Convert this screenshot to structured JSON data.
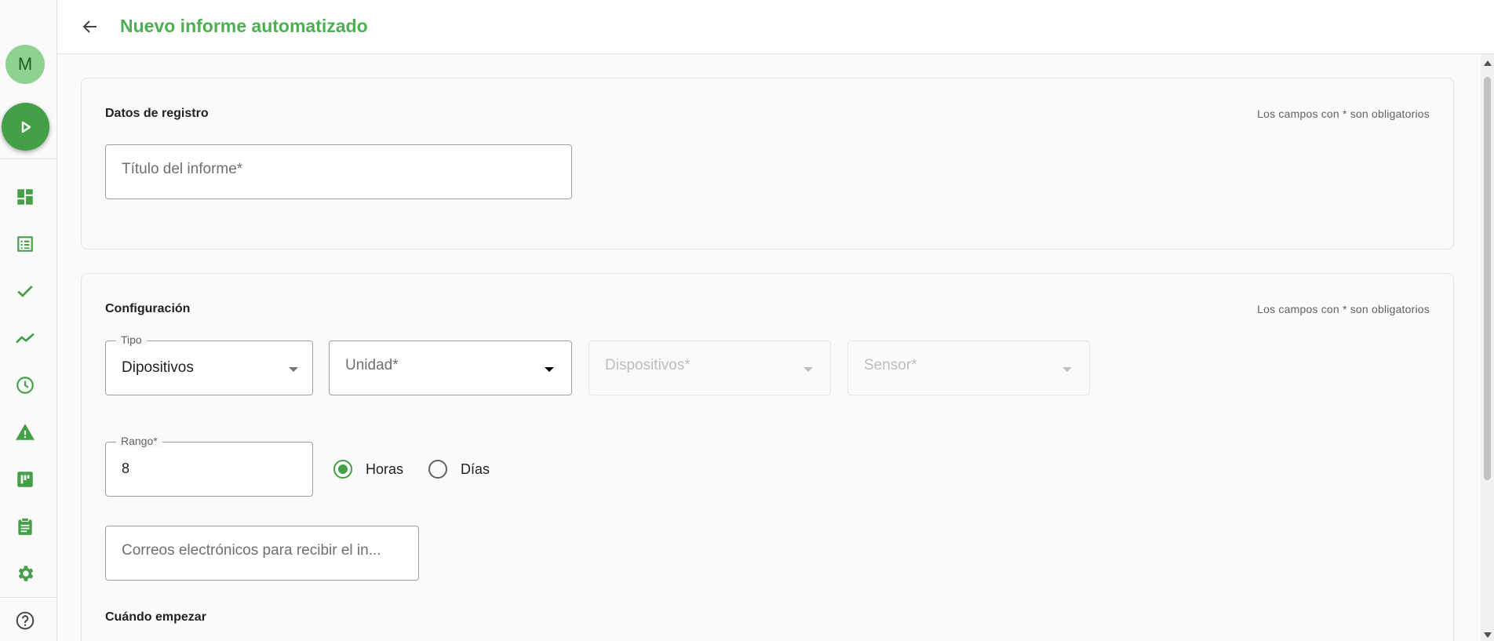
{
  "sidebar": {
    "avatar_initial": "M",
    "items": [
      {
        "icon": "dashboard-icon"
      },
      {
        "icon": "list-icon"
      },
      {
        "icon": "check-icon"
      },
      {
        "icon": "trend-icon"
      },
      {
        "icon": "clock-icon"
      },
      {
        "icon": "warning-icon"
      },
      {
        "icon": "board-icon"
      },
      {
        "icon": "clipboard-icon"
      },
      {
        "icon": "gear-icon"
      },
      {
        "icon": "help-icon"
      }
    ]
  },
  "header": {
    "title": "Nuevo informe automatizado"
  },
  "registro": {
    "title": "Datos de registro",
    "note": "Los campos con * son obligatorios",
    "titulo_placeholder": "Título del informe*"
  },
  "configuracion": {
    "title": "Configuración",
    "note": "Los campos con * son obligatorios",
    "tipo_label": "Tipo",
    "tipo_value": "Dipositivos",
    "unidad_placeholder": "Unidad*",
    "dispositivos_placeholder": "Dispositivos*",
    "sensor_placeholder": "Sensor*",
    "rango_label": "Rango*",
    "rango_value": "8",
    "horas_label": "Horas",
    "dias_label": "Días",
    "correos_placeholder": "Correos electrónicos para recibir el in...",
    "cuando_empezar": "Cuándo empezar"
  },
  "colors": {
    "accent": "#4caf50",
    "accent_dark": "#43a047",
    "avatar_bg": "#8fd18e"
  }
}
